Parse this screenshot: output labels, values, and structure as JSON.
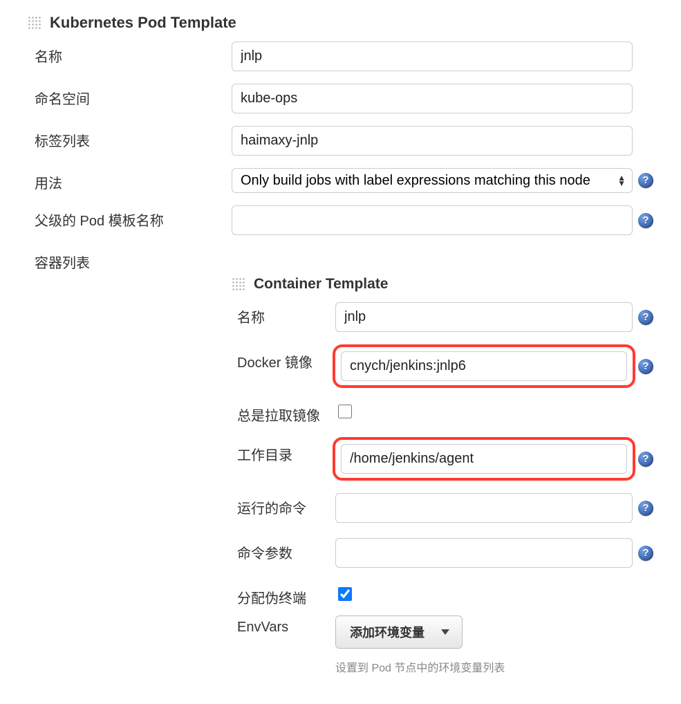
{
  "pod_template": {
    "header": "Kubernetes Pod Template",
    "fields": {
      "name": {
        "label": "名称",
        "value": "jnlp"
      },
      "namespace": {
        "label": "命名空间",
        "value": "kube-ops"
      },
      "labels": {
        "label": "标签列表",
        "value": "haimaxy-jnlp"
      },
      "usage": {
        "label": "用法",
        "value": "Only build jobs with label expressions matching this node"
      },
      "parent": {
        "label": "父级的 Pod 模板名称",
        "value": ""
      },
      "containers": {
        "label": "容器列表"
      }
    }
  },
  "container_template": {
    "header": "Container Template",
    "fields": {
      "name": {
        "label": "名称",
        "value": "jnlp"
      },
      "docker_image": {
        "label": "Docker 镜像",
        "value": "cnych/jenkins:jnlp6"
      },
      "always_pull": {
        "label": "总是拉取镜像",
        "checked": false
      },
      "working_dir": {
        "label": "工作目录",
        "value": "/home/jenkins/agent"
      },
      "command": {
        "label": "运行的命令",
        "value": ""
      },
      "args": {
        "label": "命令参数",
        "value": ""
      },
      "allocate_tty": {
        "label": "分配伪终端",
        "checked": true
      },
      "envvars": {
        "label": "EnvVars"
      }
    },
    "add_env_button": "添加环境变量",
    "envvars_hint": "设置到 Pod 节点中的环境变量列表"
  }
}
